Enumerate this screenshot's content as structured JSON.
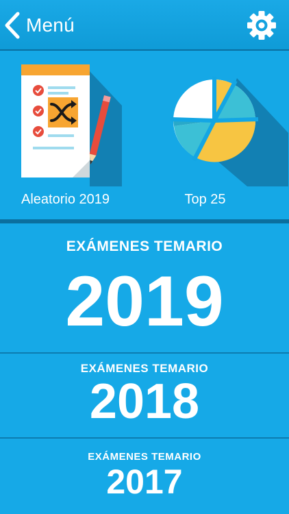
{
  "header": {
    "back_label": "Menú",
    "icons": {
      "back": "chevron-left-icon",
      "settings": "gear-icon"
    }
  },
  "tiles": [
    {
      "label": "Aleatorio 2019",
      "icon": "shuffle-checklist-icon"
    },
    {
      "label": "Top 25",
      "icon": "pie-chart-icon"
    }
  ],
  "exams": [
    {
      "subtitle": "EXÁMENES TEMARIO",
      "year": "2019"
    },
    {
      "subtitle": "EXÁMENES TEMARIO",
      "year": "2018"
    },
    {
      "subtitle": "EXÁMENES TEMARIO",
      "year": "2017"
    }
  ],
  "colors": {
    "background": "#13a6e4",
    "separator": "#0b6f9e",
    "text": "#ffffff",
    "accent_yellow": "#f7c542",
    "accent_red": "#e74c3c",
    "shadow": "#1280b3"
  }
}
